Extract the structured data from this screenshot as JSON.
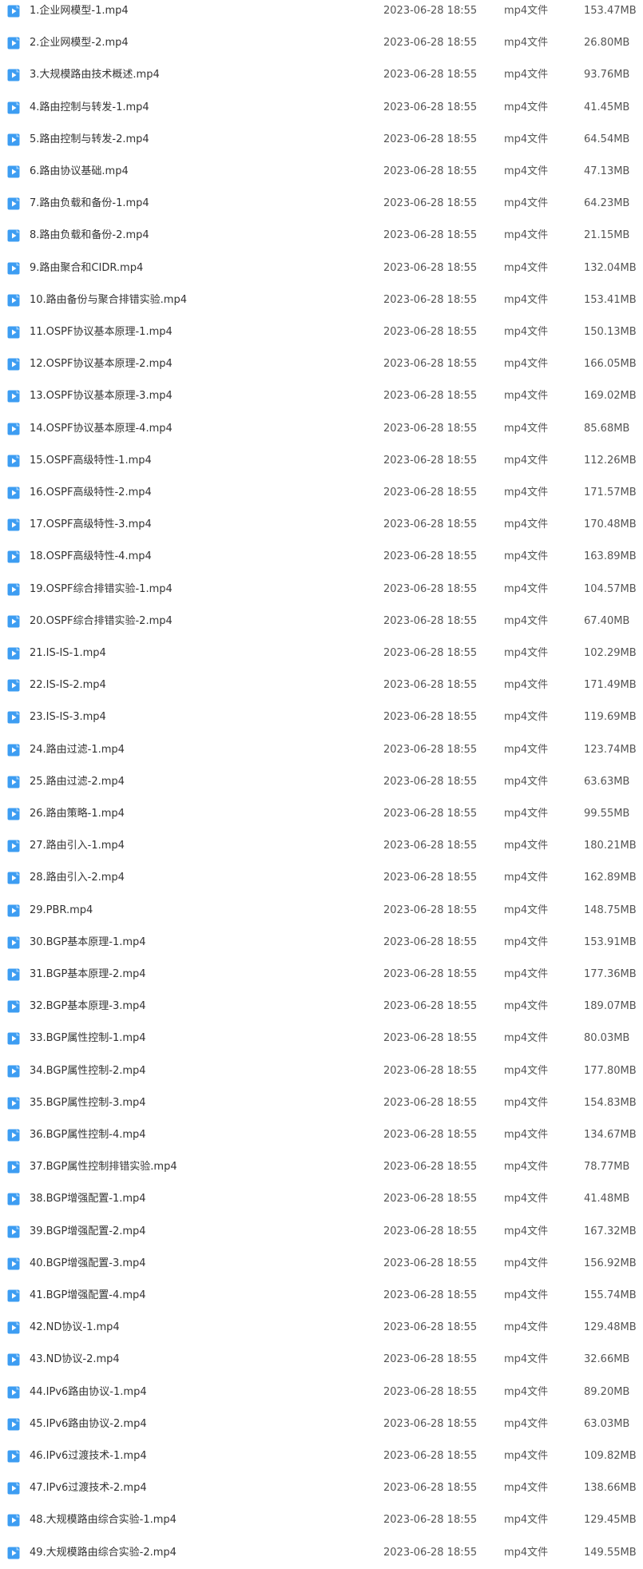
{
  "colors": {
    "icon_bg": "#3d9df2",
    "icon_play": "#ffffff",
    "text": "#333333"
  },
  "icon": "video-file-icon",
  "files": [
    {
      "name": "1.企业网模型-1.mp4",
      "date": "2023-06-28 18:55",
      "type": "mp4文件",
      "size": "153.47MB"
    },
    {
      "name": "2.企业网模型-2.mp4",
      "date": "2023-06-28 18:55",
      "type": "mp4文件",
      "size": "26.80MB"
    },
    {
      "name": "3.大规模路由技术概述.mp4",
      "date": "2023-06-28 18:55",
      "type": "mp4文件",
      "size": "93.76MB"
    },
    {
      "name": "4.路由控制与转发-1.mp4",
      "date": "2023-06-28 18:55",
      "type": "mp4文件",
      "size": "41.45MB"
    },
    {
      "name": "5.路由控制与转发-2.mp4",
      "date": "2023-06-28 18:55",
      "type": "mp4文件",
      "size": "64.54MB"
    },
    {
      "name": "6.路由协议基础.mp4",
      "date": "2023-06-28 18:55",
      "type": "mp4文件",
      "size": "47.13MB"
    },
    {
      "name": "7.路由负载和备份-1.mp4",
      "date": "2023-06-28 18:55",
      "type": "mp4文件",
      "size": "64.23MB"
    },
    {
      "name": "8.路由负载和备份-2.mp4",
      "date": "2023-06-28 18:55",
      "type": "mp4文件",
      "size": "21.15MB"
    },
    {
      "name": "9.路由聚合和CIDR.mp4",
      "date": "2023-06-28 18:55",
      "type": "mp4文件",
      "size": "132.04MB"
    },
    {
      "name": "10.路由备份与聚合排错实验.mp4",
      "date": "2023-06-28 18:55",
      "type": "mp4文件",
      "size": "153.41MB"
    },
    {
      "name": "11.OSPF协议基本原理-1.mp4",
      "date": "2023-06-28 18:55",
      "type": "mp4文件",
      "size": "150.13MB"
    },
    {
      "name": "12.OSPF协议基本原理-2.mp4",
      "date": "2023-06-28 18:55",
      "type": "mp4文件",
      "size": "166.05MB"
    },
    {
      "name": "13.OSPF协议基本原理-3.mp4",
      "date": "2023-06-28 18:55",
      "type": "mp4文件",
      "size": "169.02MB"
    },
    {
      "name": "14.OSPF协议基本原理-4.mp4",
      "date": "2023-06-28 18:55",
      "type": "mp4文件",
      "size": "85.68MB"
    },
    {
      "name": "15.OSPF高级特性-1.mp4",
      "date": "2023-06-28 18:55",
      "type": "mp4文件",
      "size": "112.26MB"
    },
    {
      "name": "16.OSPF高级特性-2.mp4",
      "date": "2023-06-28 18:55",
      "type": "mp4文件",
      "size": "171.57MB"
    },
    {
      "name": "17.OSPF高级特性-3.mp4",
      "date": "2023-06-28 18:55",
      "type": "mp4文件",
      "size": "170.48MB"
    },
    {
      "name": "18.OSPF高级特性-4.mp4",
      "date": "2023-06-28 18:55",
      "type": "mp4文件",
      "size": "163.89MB"
    },
    {
      "name": "19.OSPF综合排错实验-1.mp4",
      "date": "2023-06-28 18:55",
      "type": "mp4文件",
      "size": "104.57MB"
    },
    {
      "name": "20.OSPF综合排错实验-2.mp4",
      "date": "2023-06-28 18:55",
      "type": "mp4文件",
      "size": "67.40MB"
    },
    {
      "name": "21.IS-IS-1.mp4",
      "date": "2023-06-28 18:55",
      "type": "mp4文件",
      "size": "102.29MB"
    },
    {
      "name": "22.IS-IS-2.mp4",
      "date": "2023-06-28 18:55",
      "type": "mp4文件",
      "size": "171.49MB"
    },
    {
      "name": "23.IS-IS-3.mp4",
      "date": "2023-06-28 18:55",
      "type": "mp4文件",
      "size": "119.69MB"
    },
    {
      "name": "24.路由过滤-1.mp4",
      "date": "2023-06-28 18:55",
      "type": "mp4文件",
      "size": "123.74MB"
    },
    {
      "name": "25.路由过滤-2.mp4",
      "date": "2023-06-28 18:55",
      "type": "mp4文件",
      "size": "63.63MB"
    },
    {
      "name": "26.路由策略-1.mp4",
      "date": "2023-06-28 18:55",
      "type": "mp4文件",
      "size": "99.55MB"
    },
    {
      "name": "27.路由引入-1.mp4",
      "date": "2023-06-28 18:55",
      "type": "mp4文件",
      "size": "180.21MB"
    },
    {
      "name": "28.路由引入-2.mp4",
      "date": "2023-06-28 18:55",
      "type": "mp4文件",
      "size": "162.89MB"
    },
    {
      "name": "29.PBR.mp4",
      "date": "2023-06-28 18:55",
      "type": "mp4文件",
      "size": "148.75MB"
    },
    {
      "name": "30.BGP基本原理-1.mp4",
      "date": "2023-06-28 18:55",
      "type": "mp4文件",
      "size": "153.91MB"
    },
    {
      "name": "31.BGP基本原理-2.mp4",
      "date": "2023-06-28 18:55",
      "type": "mp4文件",
      "size": "177.36MB"
    },
    {
      "name": "32.BGP基本原理-3.mp4",
      "date": "2023-06-28 18:55",
      "type": "mp4文件",
      "size": "189.07MB"
    },
    {
      "name": "33.BGP属性控制-1.mp4",
      "date": "2023-06-28 18:55",
      "type": "mp4文件",
      "size": "80.03MB"
    },
    {
      "name": "34.BGP属性控制-2.mp4",
      "date": "2023-06-28 18:55",
      "type": "mp4文件",
      "size": "177.80MB"
    },
    {
      "name": "35.BGP属性控制-3.mp4",
      "date": "2023-06-28 18:55",
      "type": "mp4文件",
      "size": "154.83MB"
    },
    {
      "name": "36.BGP属性控制-4.mp4",
      "date": "2023-06-28 18:55",
      "type": "mp4文件",
      "size": "134.67MB"
    },
    {
      "name": "37.BGP属性控制排错实验.mp4",
      "date": "2023-06-28 18:55",
      "type": "mp4文件",
      "size": "78.77MB"
    },
    {
      "name": "38.BGP增强配置-1.mp4",
      "date": "2023-06-28 18:55",
      "type": "mp4文件",
      "size": "41.48MB"
    },
    {
      "name": "39.BGP增强配置-2.mp4",
      "date": "2023-06-28 18:55",
      "type": "mp4文件",
      "size": "167.32MB"
    },
    {
      "name": "40.BGP增强配置-3.mp4",
      "date": "2023-06-28 18:55",
      "type": "mp4文件",
      "size": "156.92MB"
    },
    {
      "name": "41.BGP增强配置-4.mp4",
      "date": "2023-06-28 18:55",
      "type": "mp4文件",
      "size": "155.74MB"
    },
    {
      "name": "42.ND协议-1.mp4",
      "date": "2023-06-28 18:55",
      "type": "mp4文件",
      "size": "129.48MB"
    },
    {
      "name": "43.ND协议-2.mp4",
      "date": "2023-06-28 18:55",
      "type": "mp4文件",
      "size": "32.66MB"
    },
    {
      "name": "44.IPv6路由协议-1.mp4",
      "date": "2023-06-28 18:55",
      "type": "mp4文件",
      "size": "89.20MB"
    },
    {
      "name": "45.IPv6路由协议-2.mp4",
      "date": "2023-06-28 18:55",
      "type": "mp4文件",
      "size": "63.03MB"
    },
    {
      "name": "46.IPv6过渡技术-1.mp4",
      "date": "2023-06-28 18:55",
      "type": "mp4文件",
      "size": "109.82MB"
    },
    {
      "name": "47.IPv6过渡技术-2.mp4",
      "date": "2023-06-28 18:55",
      "type": "mp4文件",
      "size": "138.66MB"
    },
    {
      "name": "48.大规模路由综合实验-1.mp4",
      "date": "2023-06-28 18:55",
      "type": "mp4文件",
      "size": "129.45MB"
    },
    {
      "name": "49.大规模路由综合实验-2.mp4",
      "date": "2023-06-28 18:55",
      "type": "mp4文件",
      "size": "149.55MB"
    }
  ]
}
